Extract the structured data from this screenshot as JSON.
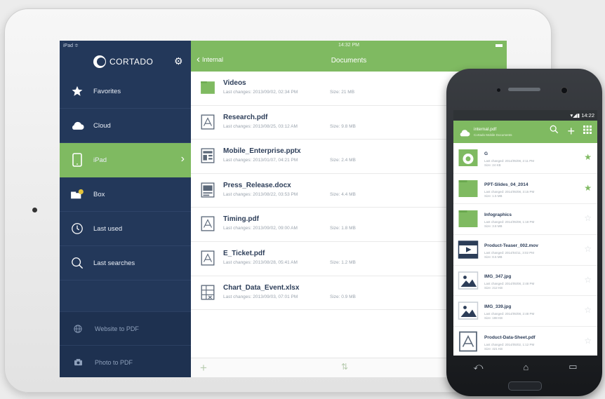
{
  "tablet": {
    "status": {
      "left": "iPad ≑",
      "time": "14:32 PM"
    },
    "sidebar": {
      "brand": "CORTADO",
      "items": [
        {
          "label": "Favorites",
          "icon": "star-icon"
        },
        {
          "label": "Cloud",
          "icon": "cloud-icon"
        },
        {
          "label": "iPad",
          "icon": "tablet-icon",
          "active": true
        },
        {
          "label": "Box",
          "icon": "box-icon"
        },
        {
          "label": "Last used",
          "icon": "clock-icon"
        },
        {
          "label": "Last searches",
          "icon": "search-icon"
        }
      ],
      "bottom": [
        {
          "label": "Website to PDF",
          "icon": "globe-icon"
        },
        {
          "label": "Photo to PDF",
          "icon": "camera-icon"
        }
      ]
    },
    "header": {
      "back_label": "Internal",
      "title": "Documents"
    },
    "files": [
      {
        "name": "Videos",
        "changed": "Last changes: 2013/09/02, 02:34 PM",
        "size": "Size: 21 MB",
        "type": "folder",
        "starred": true
      },
      {
        "name": "Research.pdf",
        "changed": "Last changes: 2013/08/25, 03:12 AM",
        "size": "Size: 9.8 MB",
        "type": "pdf",
        "starred": false
      },
      {
        "name": "Mobile_Enterprise.pptx",
        "changed": "Last changes: 2013/01/07, 04:21 PM",
        "size": "Size: 2.4 MB",
        "type": "pptx",
        "starred": false
      },
      {
        "name": "Press_Release.docx",
        "changed": "Last changes: 2013/08/22, 03:53 PM",
        "size": "Size: 4.4 MB",
        "type": "docx",
        "starred": false
      },
      {
        "name": "Timing.pdf",
        "changed": "Last changes: 2013/09/02, 09:00 AM",
        "size": "Size: 1.8 MB",
        "type": "pdf",
        "starred": false
      },
      {
        "name": "E_Ticket.pdf",
        "changed": "Last changes: 2013/08/28, 05:41 AM",
        "size": "Size: 1.2 MB",
        "type": "pdf",
        "starred": false
      },
      {
        "name": "Chart_Data_Event.xlsx",
        "changed": "Last changes: 2013/09/03, 07:01 PM",
        "size": "Size: 0.9 MB",
        "type": "xlsx",
        "starred": false
      }
    ]
  },
  "phone": {
    "status": "14:22",
    "header": {
      "title": "internal.pdf",
      "subtitle": "Cortado Mobile Documents"
    },
    "files": [
      {
        "name": "G",
        "meta1": "Last changed: 2014/05/08, 2:11 PM",
        "meta2": "Size: 24 KB",
        "type": "folder-cloud",
        "starred": true
      },
      {
        "name": "PPT-Slides_04_2014",
        "meta1": "Last changed: 2014/05/08, 3:15 PM",
        "meta2": "Size: 1.5 MB",
        "type": "folder",
        "starred": true
      },
      {
        "name": "Infographics",
        "meta1": "Last changed: 2014/05/08, 1:18 PM",
        "meta2": "Size: 3.8 MB",
        "type": "folder",
        "starred": false
      },
      {
        "name": "Product-Teaser_002.mov",
        "meta1": "Last changed: 2014/04/11, 3:02 PM",
        "meta2": "Size: 8.6 MB",
        "type": "video",
        "starred": false
      },
      {
        "name": "IMG_347.jpg",
        "meta1": "Last changed: 2014/05/08, 2:48 PM",
        "meta2": "Size: 212 KB",
        "type": "image",
        "starred": false
      },
      {
        "name": "IMG_339.jpg",
        "meta1": "Last changed: 2014/05/08, 2:48 PM",
        "meta2": "Size: 198 KB",
        "type": "image",
        "starred": false
      },
      {
        "name": "Product-Data-Sheet.pdf",
        "meta1": "Last changed: 2014/05/02, 1:12 PM",
        "meta2": "Size: 421 KB",
        "type": "pdf",
        "starred": false
      }
    ]
  },
  "colors": {
    "accent": "#7fba61",
    "sidebar": "#23385a",
    "text_dark": "#2c3d58"
  }
}
